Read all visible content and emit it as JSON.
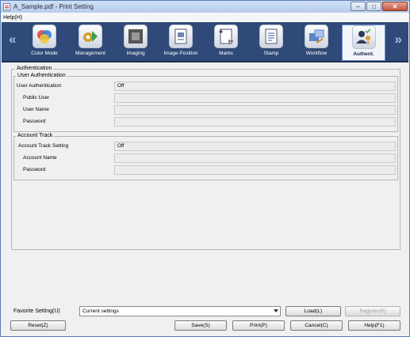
{
  "window": {
    "title": "A_Sample.pdf - Print Setting",
    "controls": {
      "minimize": "–",
      "maximize": "□",
      "close": "✕"
    }
  },
  "menu": {
    "help": "Help(H)"
  },
  "toolbar": {
    "prev_arrow": "«",
    "next_arrow": "»",
    "tabs": [
      {
        "label": "Color Mode",
        "icon": "color-mode-icon"
      },
      {
        "label": "Management",
        "icon": "management-icon"
      },
      {
        "label": "Imaging",
        "icon": "imaging-icon"
      },
      {
        "label": "Image Position",
        "icon": "image-position-icon"
      },
      {
        "label": "Marks",
        "icon": "marks-icon"
      },
      {
        "label": "Stamp",
        "icon": "stamp-icon"
      },
      {
        "label": "Workflow",
        "icon": "workflow-icon"
      },
      {
        "label": "Authent.",
        "icon": "authentication-icon",
        "active": true
      }
    ]
  },
  "authentication": {
    "legend": "Authentication",
    "user_auth": {
      "legend": "User Authentication",
      "rows": [
        {
          "label": "User Authentication",
          "value": "Off"
        },
        {
          "label": "Public User",
          "value": ""
        },
        {
          "label": "User Name",
          "value": ""
        },
        {
          "label": "Password",
          "value": ""
        }
      ]
    },
    "account_track": {
      "legend": "Account Track",
      "rows": [
        {
          "label": "Account Track Setting",
          "value": "Off"
        },
        {
          "label": "Account Name",
          "value": ""
        },
        {
          "label": "Password",
          "value": ""
        }
      ]
    }
  },
  "favorite": {
    "label": "Favorite Setting(U)",
    "selected": "Current settings",
    "load_button": "Load(L)",
    "register_button": "Register(R)"
  },
  "footer": {
    "reset_button": "Reset(Z)",
    "save_button": "Save(S)",
    "print_button": "Print(P)",
    "cancel_button": "Cancel(C)",
    "help_button": "Help(F1)"
  },
  "colors": {
    "toolbar_bg": "#2f4a78",
    "active_tab_bg": "#f2f5fa",
    "window_border": "#5a7fb5"
  }
}
